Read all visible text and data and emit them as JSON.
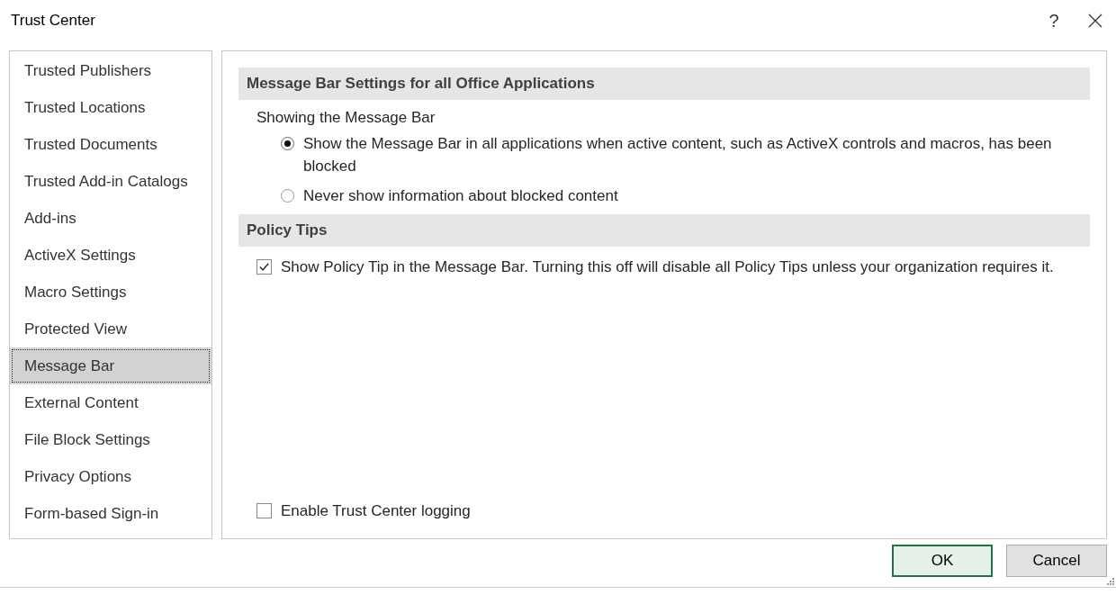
{
  "window": {
    "title": "Trust Center",
    "help": "?"
  },
  "sidebar": {
    "items": [
      {
        "label": "Trusted Publishers",
        "selected": false
      },
      {
        "label": "Trusted Locations",
        "selected": false
      },
      {
        "label": "Trusted Documents",
        "selected": false
      },
      {
        "label": "Trusted Add-in Catalogs",
        "selected": false
      },
      {
        "label": "Add-ins",
        "selected": false
      },
      {
        "label": "ActiveX Settings",
        "selected": false
      },
      {
        "label": "Macro Settings",
        "selected": false
      },
      {
        "label": "Protected View",
        "selected": false
      },
      {
        "label": "Message Bar",
        "selected": true
      },
      {
        "label": "External Content",
        "selected": false
      },
      {
        "label": "File Block Settings",
        "selected": false
      },
      {
        "label": "Privacy Options",
        "selected": false
      },
      {
        "label": "Form-based Sign-in",
        "selected": false
      }
    ]
  },
  "sections": [
    {
      "heading": "Message Bar Settings for all Office Applications",
      "subheading": "Showing the Message Bar",
      "options": [
        {
          "kind": "radio",
          "label": "Show the Message Bar in all applications when active content, such as ActiveX controls and macros, has been blocked",
          "selected": true
        },
        {
          "kind": "radio",
          "label": "Never show information about blocked content",
          "selected": false
        }
      ]
    },
    {
      "heading": "Policy Tips",
      "options": [
        {
          "kind": "checkbox",
          "label": "Show Policy Tip in the Message Bar. Turning this off will disable all Policy Tips unless your organization requires it.",
          "checked": true
        }
      ]
    }
  ],
  "logging": {
    "label": "Enable Trust Center logging",
    "checked": false
  },
  "buttons": [
    {
      "label": "OK",
      "default": true
    },
    {
      "label": "Cancel",
      "default": false
    }
  ]
}
